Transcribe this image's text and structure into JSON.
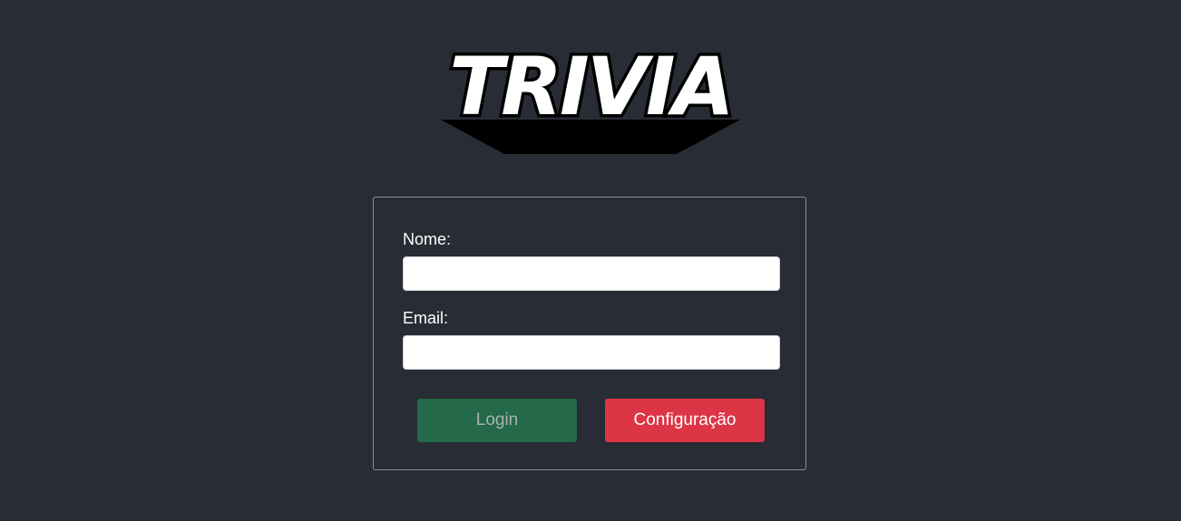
{
  "app": {
    "logo_text": "TRIVIA"
  },
  "form": {
    "name_label": "Nome:",
    "name_value": "",
    "name_placeholder": "",
    "email_label": "Email:",
    "email_value": "",
    "email_placeholder": "",
    "login_button": "Login",
    "login_enabled": false,
    "config_button": "Configuração"
  },
  "colors": {
    "background": "#282c34",
    "card_border": "#8a8d93",
    "login_button_bg": "#23694a",
    "config_button_bg": "#dc3545"
  }
}
